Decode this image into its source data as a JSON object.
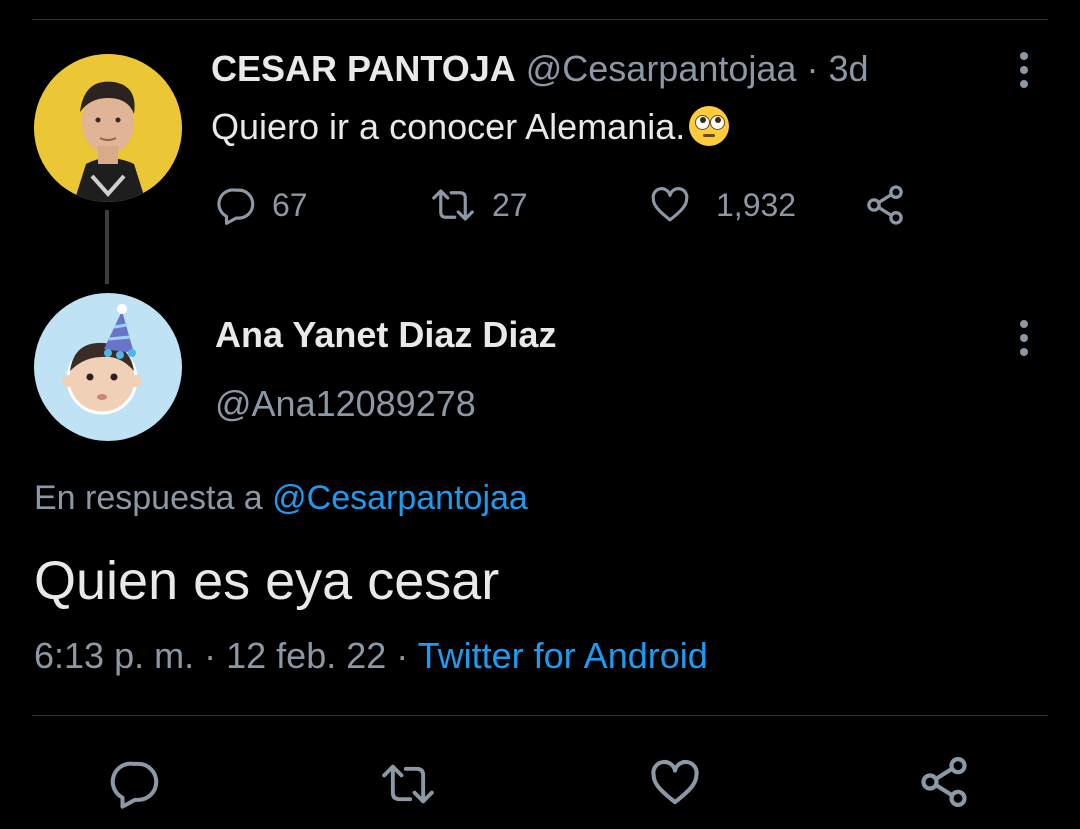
{
  "parent_tweet": {
    "author_name": "CESAR PANTOJA",
    "author_handle": "@Cesarpantojaa",
    "separator": "·",
    "time_ago": "3d",
    "text": "Quiero ir a conocer Alemania.",
    "emoji": "face-with-rolling-eyes",
    "stats": {
      "replies": "67",
      "retweets": "27",
      "likes": "1,932"
    },
    "avatar_bg": "#e9c231"
  },
  "reply_tweet": {
    "author_name": "Ana Yanet Diaz Diaz",
    "author_handle": "@Ana12089278",
    "reply_prefix": "En respuesta a",
    "reply_to_handle": "@Cesarpantojaa",
    "text": "Quien es eya cesar",
    "time": "6:13 p. m.",
    "date": "12 feb. 22",
    "separator": "·",
    "source": "Twitter for Android",
    "avatar_bg": "#bfe3f4"
  },
  "colors": {
    "background": "#000000",
    "text": "#e7e9ea",
    "muted": "#8b98a5",
    "link": "#1d9bf0",
    "divider": "#2f3336"
  },
  "icons": [
    "reply-icon",
    "retweet-icon",
    "like-icon",
    "share-icon",
    "more-options-icon"
  ]
}
